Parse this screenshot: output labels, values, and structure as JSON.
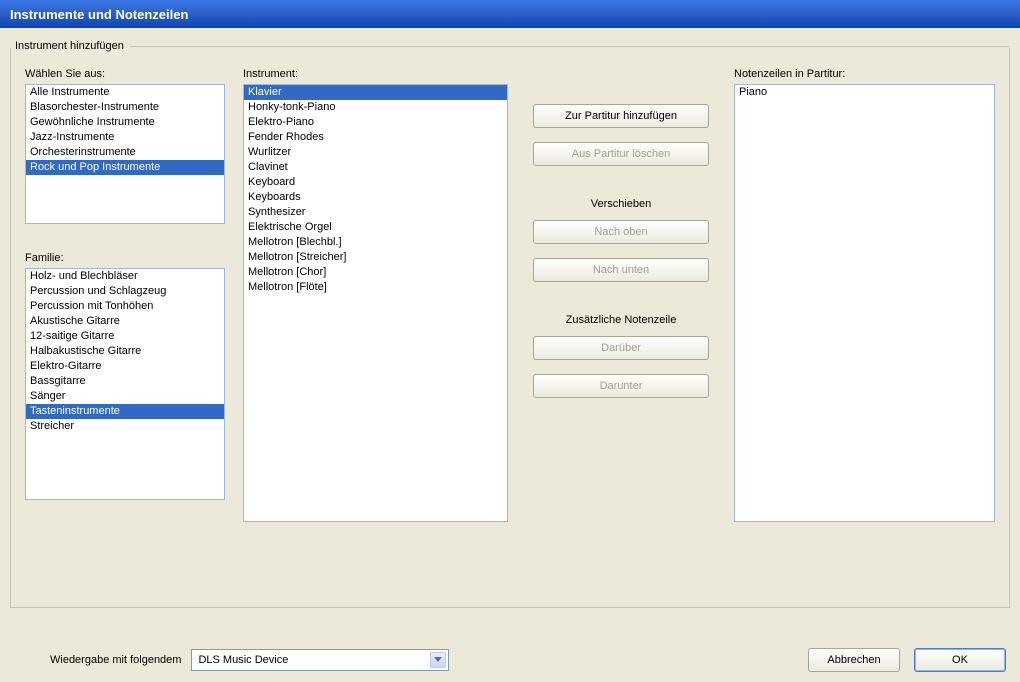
{
  "title": "Instrumente und Notenzeilen",
  "groupbox_title": "Instrument hinzufügen",
  "labels": {
    "choose_from": "Wählen Sie aus:",
    "family": "Familie:",
    "instrument": "Instrument:",
    "staves": "Notenzeilen in Partitur:",
    "move": "Verschieben",
    "extra_staff": "Zusätzliche Notenzeile",
    "playback_device": "Wiedergabe mit folgendem"
  },
  "categories": [
    "Alle Instrumente",
    "Blasorchester-Instrumente",
    "Gewöhnliche Instrumente",
    "Jazz-Instrumente",
    "Orchesterinstrumente",
    "Rock und Pop Instrumente"
  ],
  "categories_selected_index": 5,
  "families": [
    "Holz- und Blechbläser",
    "Percussion und Schlagzeug",
    "Percussion mit Tonhöhen",
    "Akustische Gitarre",
    "12-saitige Gitarre",
    "Halbakustische Gitarre",
    "Elektro-Gitarre",
    "Bassgitarre",
    "Sänger",
    "Tasteninstrumente",
    "Streicher"
  ],
  "families_selected_index": 9,
  "instruments": [
    "Klavier",
    "Honky-tonk-Piano",
    "Elektro-Piano",
    "Fender Rhodes",
    "Wurlitzer",
    "Clavinet",
    "Keyboard",
    "Keyboards",
    "Synthesizer",
    "Elektrische Orgel",
    "Mellotron [Blechbl.]",
    "Mellotron [Streicher]",
    "Mellotron [Chor]",
    "Mellotron [Flöte]"
  ],
  "instruments_selected_index": 0,
  "staves": [
    "Piano"
  ],
  "staves_selected_index": -1,
  "buttons": {
    "add_to_score": "Zur Partitur hinzufügen",
    "delete_from_score": "Aus Partitur löschen",
    "move_up": "Nach oben",
    "move_down": "Nach unten",
    "above": "Darüber",
    "below": "Darunter",
    "cancel": "Abbrechen",
    "ok": "OK"
  },
  "playback_device_value": "DLS Music Device"
}
